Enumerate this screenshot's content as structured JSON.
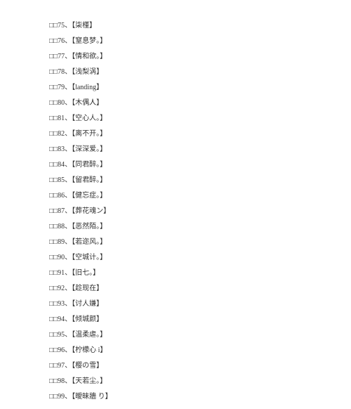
{
  "items": [
    {
      "num": "75",
      "text": "【柒槿】"
    },
    {
      "num": "76",
      "text": "【窒息梦。】"
    },
    {
      "num": "77",
      "text": "【情和欲。】"
    },
    {
      "num": "78",
      "text": "【浅梨涡】"
    },
    {
      "num": "79",
      "text": "【landing】"
    },
    {
      "num": "80",
      "text": "【木偶㆟】"
    },
    {
      "num": "81",
      "text": "【空心人。】"
    },
    {
      "num": "82",
      "text": "【离不开。】"
    },
    {
      "num": "83",
      "text": "【深深爱。】"
    },
    {
      "num": "84",
      "text": "【同君醉。】"
    },
    {
      "num": "85",
      "text": "【留君醉。】"
    },
    {
      "num": "86",
      "text": "【健忘症。】"
    },
    {
      "num": "87",
      "text": "【葬花魂ン】"
    },
    {
      "num": "88",
      "text": "【恶然陌。】"
    },
    {
      "num": "89",
      "text": "【若迩风。】"
    },
    {
      "num": "90",
      "text": "【空城计。】"
    },
    {
      "num": "91",
      "text": "【旧七。】"
    },
    {
      "num": "92",
      "text": "【趁现在】"
    },
    {
      "num": "93",
      "text": "【讨人嫌】"
    },
    {
      "num": "94",
      "text": "【倾城颜】"
    },
    {
      "num": "95",
      "text": "【温柔虐。】"
    },
    {
      "num": "96",
      "text": "【柠檬心 i】"
    },
    {
      "num": "97",
      "text": "【樱の雪】"
    },
    {
      "num": "98",
      "text": "【天若尘。】"
    },
    {
      "num": "99",
      "text": "【曖昧牆 り】"
    }
  ],
  "prefix_chars": "□□",
  "separator": "、"
}
